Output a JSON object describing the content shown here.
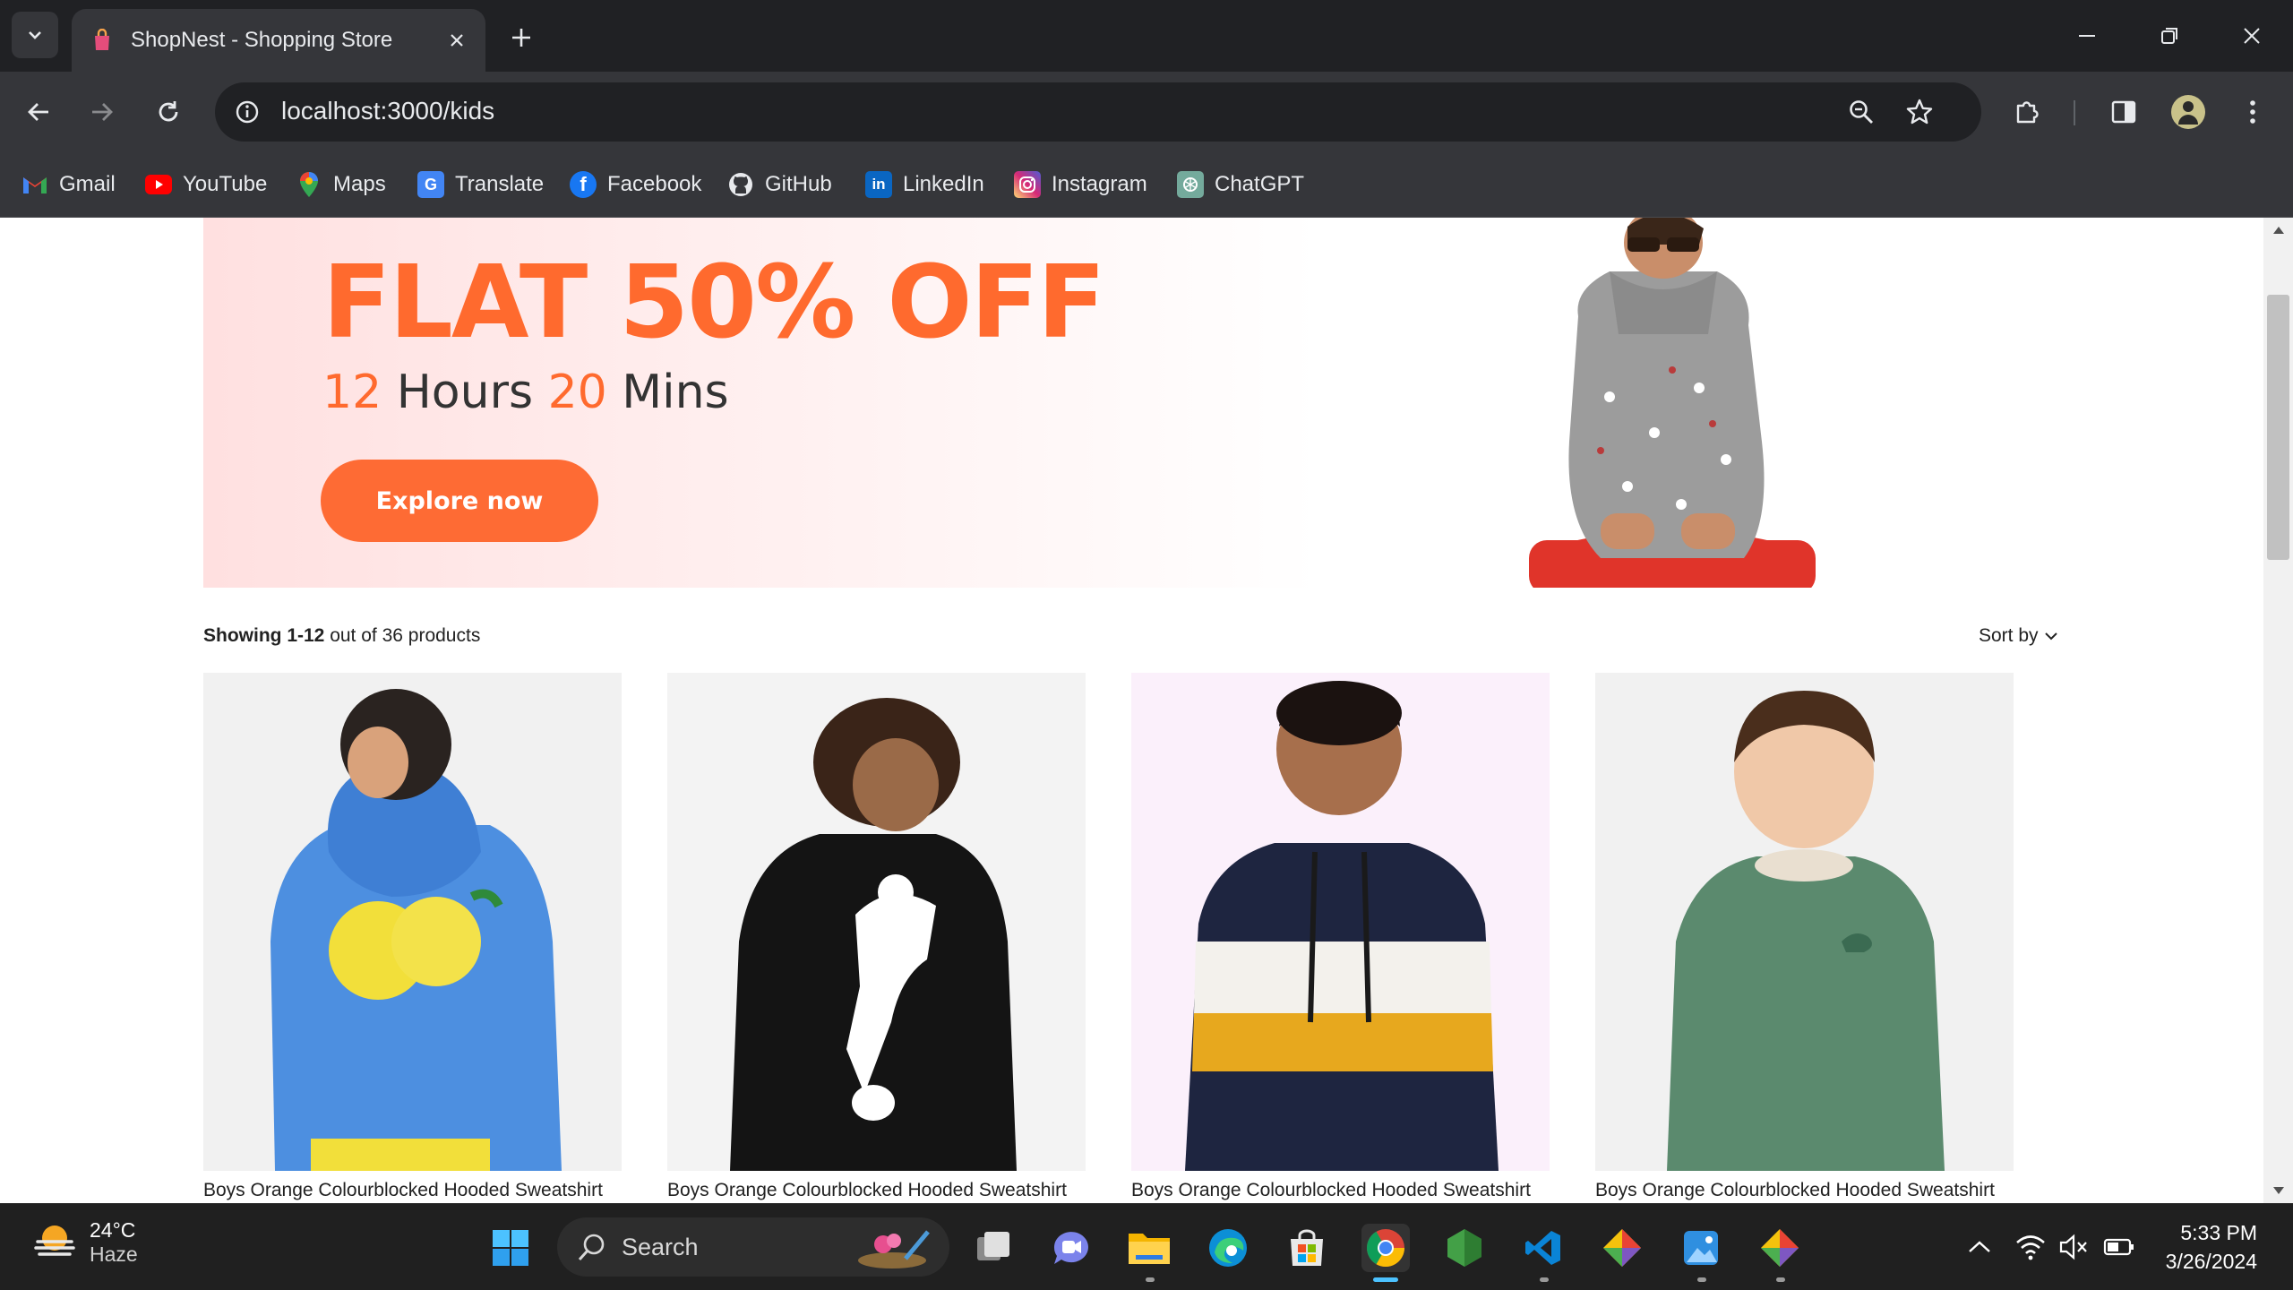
{
  "browser": {
    "tab_title": "ShopNest - Shopping Store",
    "url": "localhost:3000/kids",
    "bookmarks": [
      {
        "label": "Gmail",
        "icon": "gmail-icon"
      },
      {
        "label": "YouTube",
        "icon": "youtube-icon"
      },
      {
        "label": "Maps",
        "icon": "maps-icon"
      },
      {
        "label": "Translate",
        "icon": "translate-icon"
      },
      {
        "label": "Facebook",
        "icon": "facebook-icon"
      },
      {
        "label": "GitHub",
        "icon": "github-icon"
      },
      {
        "label": "LinkedIn",
        "icon": "linkedin-icon"
      },
      {
        "label": "Instagram",
        "icon": "instagram-icon"
      },
      {
        "label": "ChatGPT",
        "icon": "chatgpt-icon"
      }
    ]
  },
  "hero": {
    "headline": "FLAT 50% OFF",
    "timer_hours": "12",
    "timer_hours_label": "Hours",
    "timer_mins": "20",
    "timer_mins_label": "Mins",
    "cta_label": "Explore now"
  },
  "listing": {
    "showing_range": "Showing 1-12",
    "showing_rest": "out of 36 products",
    "sort_label": "Sort by"
  },
  "products": [
    {
      "name": "Boys Orange Colourblocked Hooded Sweatshirt",
      "image": "blue-lemon-hoodie"
    },
    {
      "name": "Boys Orange Colourblocked Hooded Sweatshirt",
      "image": "black-football-hoodie"
    },
    {
      "name": "Boys Orange Colourblocked Hooded Sweatshirt",
      "image": "striped-navy-yellow-hoodie"
    },
    {
      "name": "Boys Orange Colourblocked Hooded Sweatshirt",
      "image": "green-dino-sweatshirt"
    }
  ],
  "taskbar": {
    "weather_temp": "24°C",
    "weather_cond": "Haze",
    "search_label": "Search",
    "time": "5:33 PM",
    "date": "3/26/2024"
  },
  "colors": {
    "accent": "#fe6b34",
    "chrome_dark": "#202124",
    "chrome_toolbar": "#35363a"
  }
}
